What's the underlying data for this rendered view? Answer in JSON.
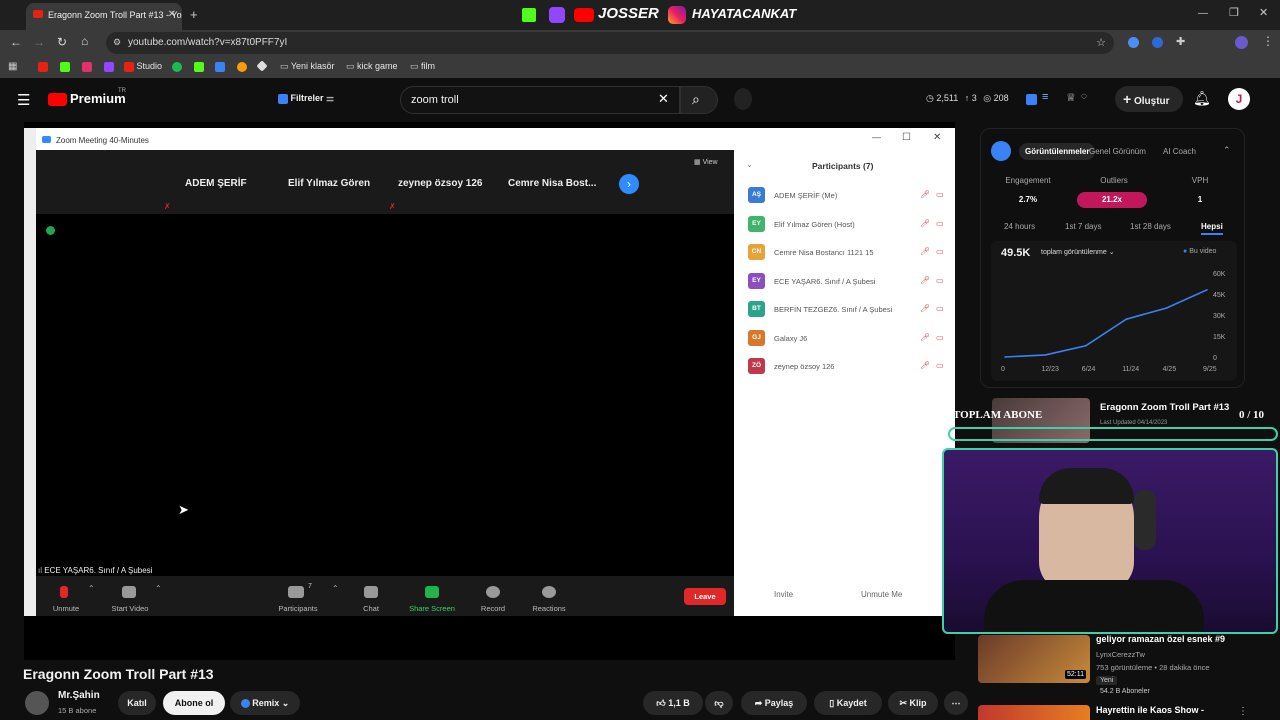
{
  "browser": {
    "tab_title": "Eragonn Zoom Troll Part #13 - Yo",
    "url": "youtube.com/watch?v=x87t0PFF7yI",
    "bookmarks": [
      "Studio",
      "Yeni klasör",
      "kick game",
      "film"
    ]
  },
  "overlay_banner": {
    "left": "JOSSER",
    "right": "HAYATACANKAT"
  },
  "youtube": {
    "logo": "Premium",
    "logo_badge": "TR",
    "filters_label": "Filtreler",
    "search_value": "zoom troll",
    "stats": [
      "2,511",
      "3",
      "208"
    ],
    "create_label": "Oluştur",
    "avatar_letter": "J"
  },
  "zoom": {
    "title": "Zoom Meeting 40-Minutes",
    "view_label": "View",
    "gallery_names": [
      "ADEM ŞERİF",
      "Elif Yılmaz Gören",
      "zeynep özsoy 126",
      "Cemre Nisa Bost..."
    ],
    "active_speaker": "ECE YAŞAR6. Sınıf / A Şubesi",
    "toolbar": {
      "unmute": "Unmute",
      "start_video": "Start Video",
      "participants": "Participants",
      "participants_count": "7",
      "chat": "Chat",
      "share_screen": "Share Screen",
      "record": "Record",
      "reactions": "Reactions",
      "leave": "Leave"
    },
    "participants_panel": {
      "title": "Participants (7)",
      "list": [
        {
          "initials": "AŞ",
          "name": "ADEM ŞERİF (Me)",
          "color": "#3a7bd5"
        },
        {
          "initials": "EY",
          "name": "Elif Yılmaz Gören (Host)",
          "color": "#3fb56a"
        },
        {
          "initials": "CN",
          "name": "Cemre Nisa Bostancı 1121 15",
          "color": "#e8a23a"
        },
        {
          "initials": "EY",
          "name": "ECE YAŞAR6. Sınıf / A Şubesi",
          "color": "#8c4fc0"
        },
        {
          "initials": "BT",
          "name": "BERFİN TEZGEZ6. Sınıf / A Şubesi",
          "color": "#2aa58c"
        },
        {
          "initials": "GJ",
          "name": "Galaxy J6",
          "color": "#d9782a"
        },
        {
          "initials": "ZÖ",
          "name": "zeynep özsoy 126",
          "color": "#c0394a"
        }
      ],
      "invite": "Invite",
      "unmute_me": "Unmute Me"
    }
  },
  "analytics": {
    "tabs": [
      "Görüntülenmeler",
      "Genel Görünüm",
      "AI Coach"
    ],
    "metric_labels": [
      "Engagement",
      "Outliers",
      "VPH"
    ],
    "metric_values": [
      "2.7%",
      "21.2x",
      "1"
    ],
    "periods": [
      "24 hours",
      "1st 7 days",
      "1st 28 days",
      "Hepsi"
    ],
    "total": "49.5K",
    "total_label": "toplam görüntülenme",
    "legend": "Bu video",
    "y_ticks": [
      "60K",
      "45K",
      "30K",
      "15K",
      "0"
    ],
    "x_ticks": [
      "0",
      "12/23",
      "6/24",
      "11/24",
      "4/25",
      "9/25"
    ]
  },
  "chart_data": {
    "type": "line",
    "x": [
      "0",
      "12/23",
      "6/24",
      "11/24",
      "4/25",
      "9/25"
    ],
    "series": [
      {
        "name": "Bu video",
        "values": [
          0,
          1500,
          8000,
          27000,
          35000,
          48000
        ]
      }
    ],
    "ylim": [
      0,
      60000
    ]
  },
  "sidebar_card": {
    "title": "Eragonn Zoom Troll Part #13",
    "sub": "Last Updated 04/14/2023",
    "overlay_left": "TOPLAM ABONE",
    "overlay_right": "0 / 10"
  },
  "video": {
    "title": "Eragonn Zoom Troll Part #13",
    "channel": "Mr.Şahin",
    "subs": "15 B abone",
    "join": "Katıl",
    "subscribe": "Abone ol",
    "remix": "Remix",
    "likes": "1,1 B",
    "share": "Paylaş",
    "save": "Kaydet",
    "clip": "Klip"
  },
  "recommended": [
    {
      "title": "geliyor ramazan özel esnek #9",
      "channel": "LynxCerezzTw",
      "meta": "753 görüntüleme • 28 dakika önce",
      "badge": "Yeni",
      "duration": "52:11",
      "subs": "54.2 B Aboneler"
    },
    {
      "title": "Hayrettin ile Kaos Show -"
    }
  ]
}
